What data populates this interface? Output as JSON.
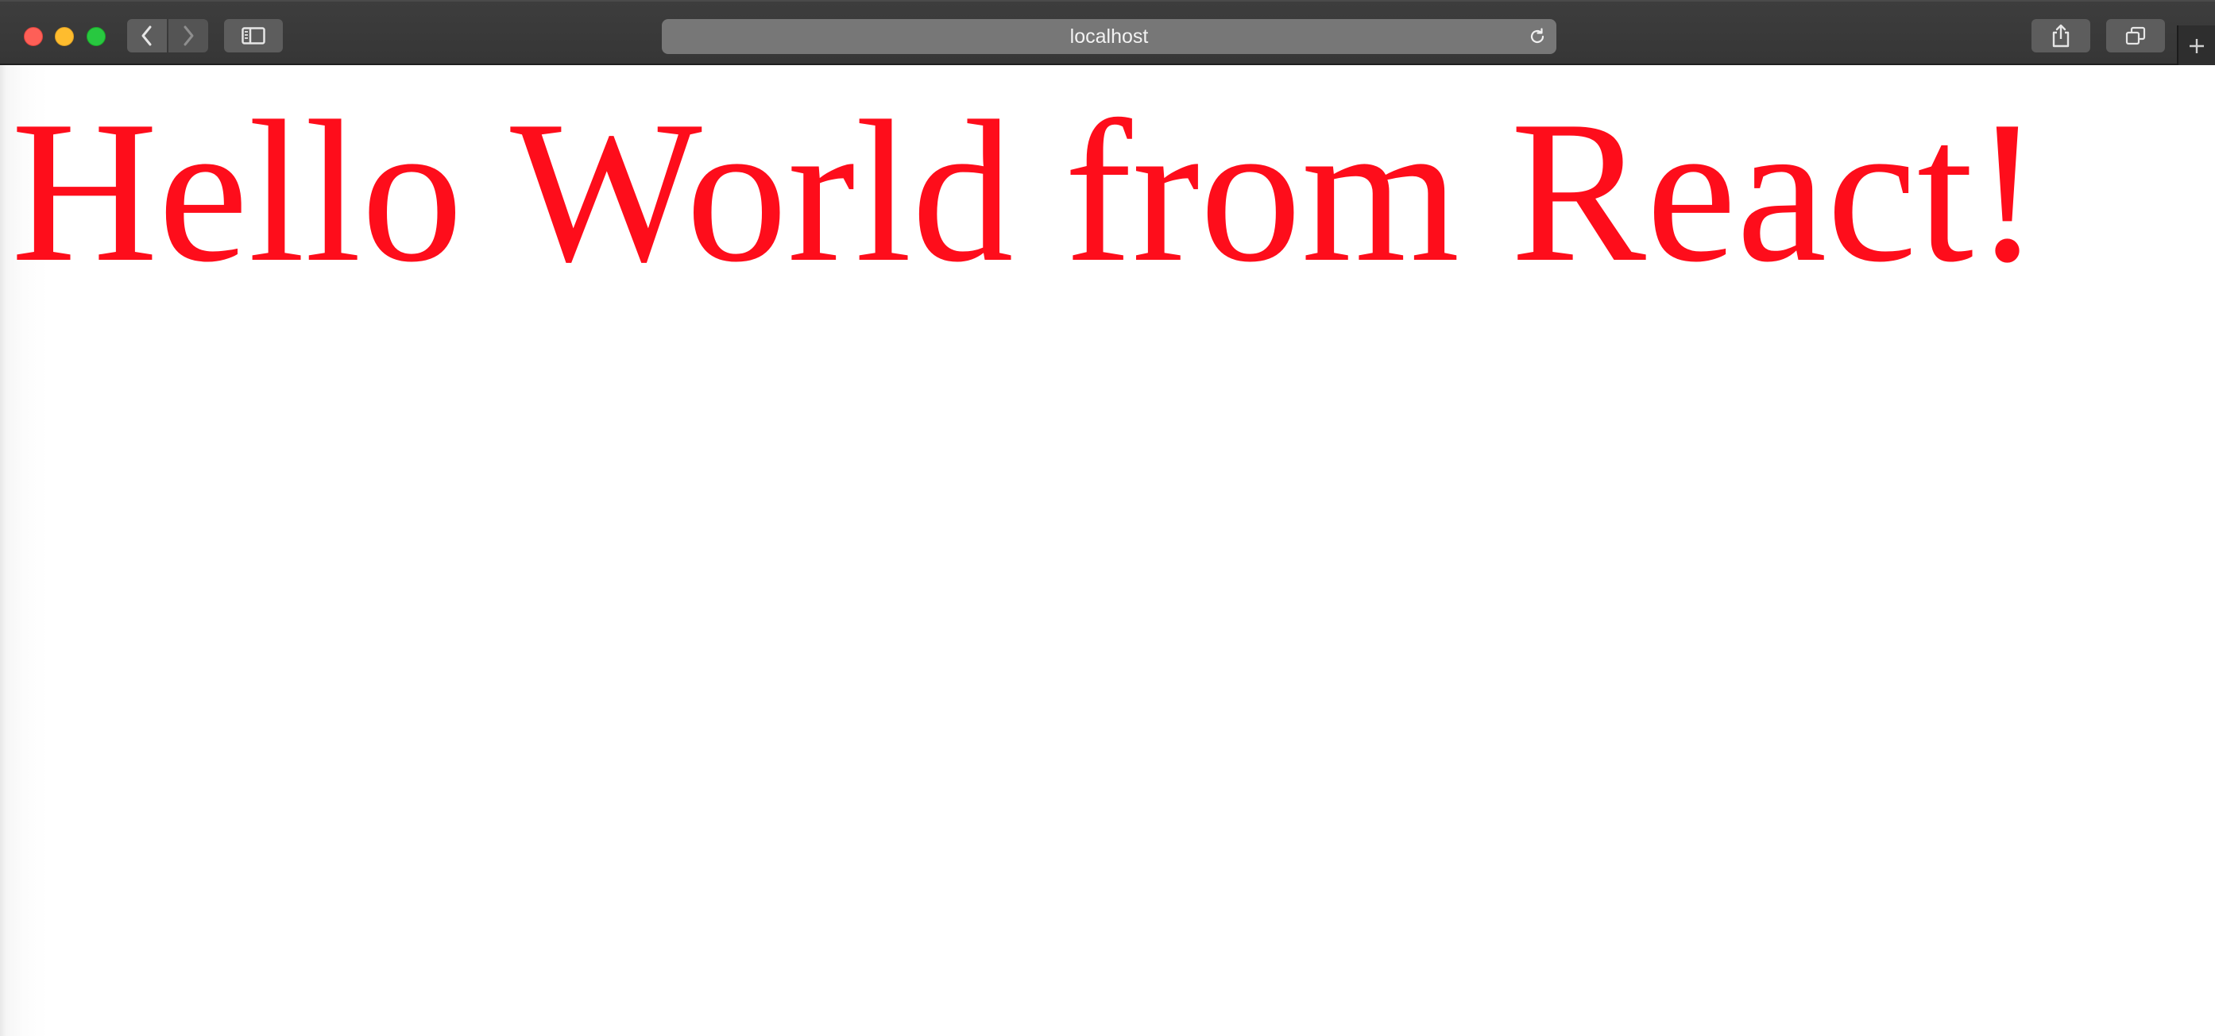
{
  "browser": {
    "address": "localhost",
    "toolbar": {
      "back_icon": "chevron-left-icon",
      "forward_icon": "chevron-right-icon",
      "sidebar_icon": "sidebar-icon",
      "reload_icon": "reload-icon",
      "share_icon": "share-icon",
      "tabs_icon": "tabs-overview-icon",
      "new_tab_icon": "plus-icon"
    }
  },
  "page": {
    "heading": "Hello World from React!",
    "heading_color": "#fe0d1b"
  }
}
